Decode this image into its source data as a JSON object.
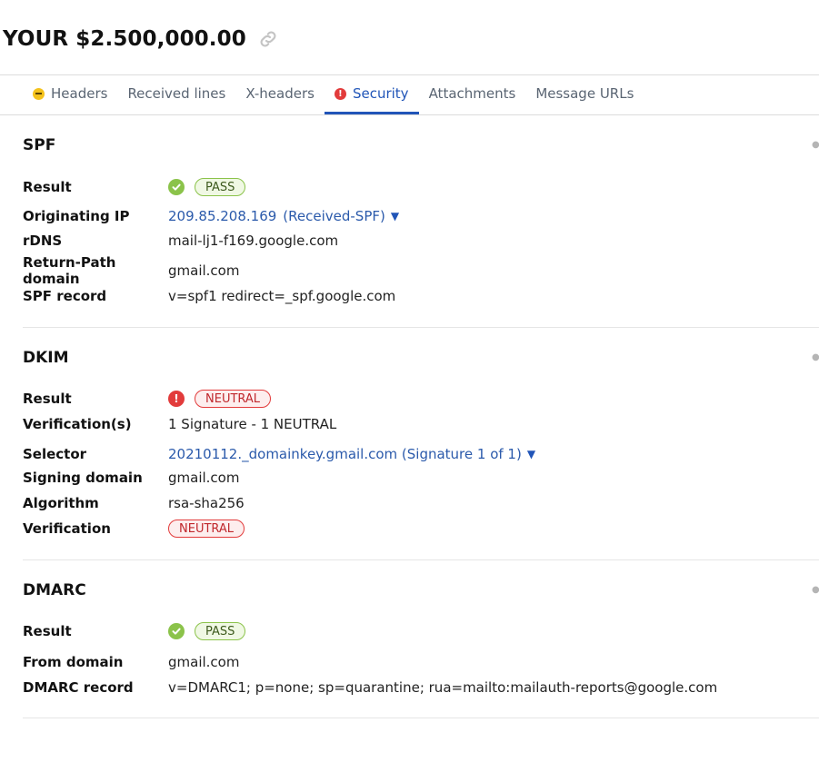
{
  "title": "YOUR $2.500,000.00",
  "tabs": [
    {
      "label": "Headers",
      "status": "warning"
    },
    {
      "label": "Received lines"
    },
    {
      "label": "X-headers"
    },
    {
      "label": "Security",
      "status": "error",
      "active": true
    },
    {
      "label": "Attachments"
    },
    {
      "label": "Message URLs"
    }
  ],
  "spf": {
    "heading": "SPF",
    "result_label": "Result",
    "result": "PASS",
    "originating_ip_label": "Originating IP",
    "originating_ip": "209.85.208.169",
    "originating_ip_source": "(Received-SPF)",
    "rdns_label": "rDNS",
    "rdns": "mail-lj1-f169.google.com",
    "return_path_label": "Return-Path domain",
    "return_path": "gmail.com",
    "record_label": "SPF record",
    "record": "v=spf1 redirect=_spf.google.com"
  },
  "dkim": {
    "heading": "DKIM",
    "result_label": "Result",
    "result": "NEUTRAL",
    "verifications_label": "Verification(s)",
    "verifications": "1 Signature - 1 NEUTRAL",
    "selector_label": "Selector",
    "selector": "20210112._domainkey.gmail.com (Signature 1 of 1)",
    "signing_domain_label": "Signing domain",
    "signing_domain": "gmail.com",
    "algorithm_label": "Algorithm",
    "algorithm": "rsa-sha256",
    "verification_label": "Verification",
    "verification": "NEUTRAL"
  },
  "dmarc": {
    "heading": "DMARC",
    "result_label": "Result",
    "result": "PASS",
    "from_domain_label": "From domain",
    "from_domain": "gmail.com",
    "record_label": "DMARC record",
    "record": "v=DMARC1; p=none; sp=quarantine; rua=mailto:mailauth-reports@google.com"
  },
  "colors": {
    "accent": "#2155b8",
    "pass": "#8bc34a",
    "fail": "#e23b3b",
    "warning": "#f4c21b"
  },
  "icons": [
    "link-icon",
    "warning-icon",
    "error-icon",
    "check-icon",
    "caret-down-icon",
    "more-icon"
  ]
}
